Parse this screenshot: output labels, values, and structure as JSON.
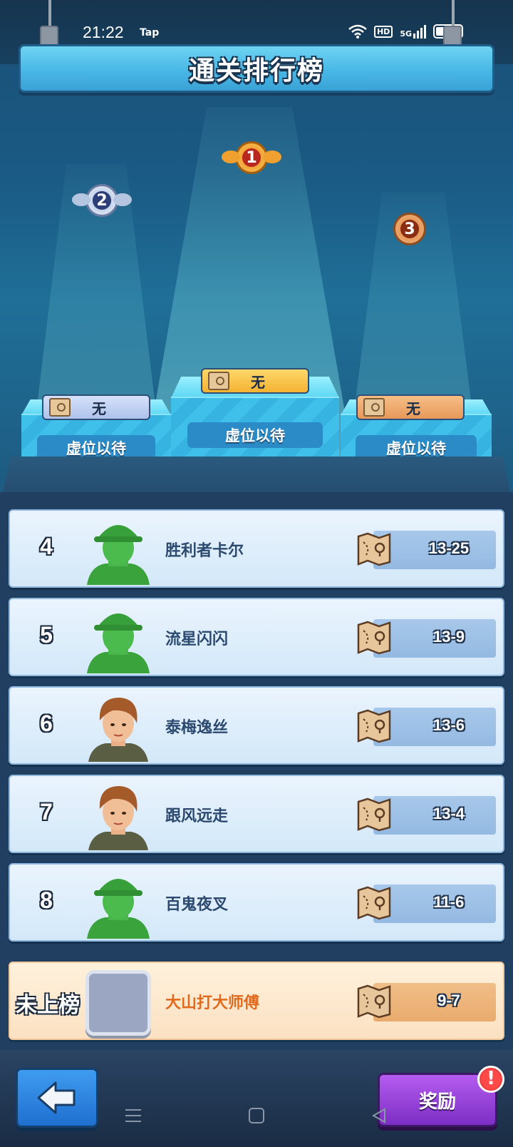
{
  "status_bar": {
    "time": "21:22",
    "app_tag": "Tap",
    "icons": [
      "wifi-icon",
      "hd-icon",
      "5g-signal-icon",
      "battery-icon"
    ],
    "hd_label": "HD",
    "net_label": "5G"
  },
  "title": "通关排行榜",
  "podium": {
    "first": {
      "medal": "1",
      "stage": "无",
      "label": "虚位以待"
    },
    "second": {
      "medal": "2",
      "stage": "无",
      "label": "虚位以待"
    },
    "third": {
      "medal": "3",
      "stage": "无",
      "label": "虚位以待"
    }
  },
  "leaderboard": [
    {
      "rank": "4",
      "name": "胜利者卡尔",
      "stage": "13-25",
      "avatar": "green-soldier"
    },
    {
      "rank": "5",
      "name": "流星闪闪",
      "stage": "13-9",
      "avatar": "green-soldier"
    },
    {
      "rank": "6",
      "name": "泰梅逸丝",
      "stage": "13-6",
      "avatar": "female-soldier"
    },
    {
      "rank": "7",
      "name": "跟风远走",
      "stage": "13-4",
      "avatar": "female-soldier"
    },
    {
      "rank": "8",
      "name": "百鬼夜叉",
      "stage": "11-6",
      "avatar": "green-soldier"
    }
  ],
  "me": {
    "rank": "未上榜",
    "name": "大山打大师傅",
    "stage": "9-7"
  },
  "buttons": {
    "back": "back-arrow-icon",
    "reward": "奖励",
    "alert": "!"
  },
  "colors": {
    "accent_blue": "#48b8e6",
    "gold": "#f4b232",
    "bronze": "#e8985a",
    "me_name": "#e06a1e",
    "reward_purple": "#7c2ec4"
  }
}
